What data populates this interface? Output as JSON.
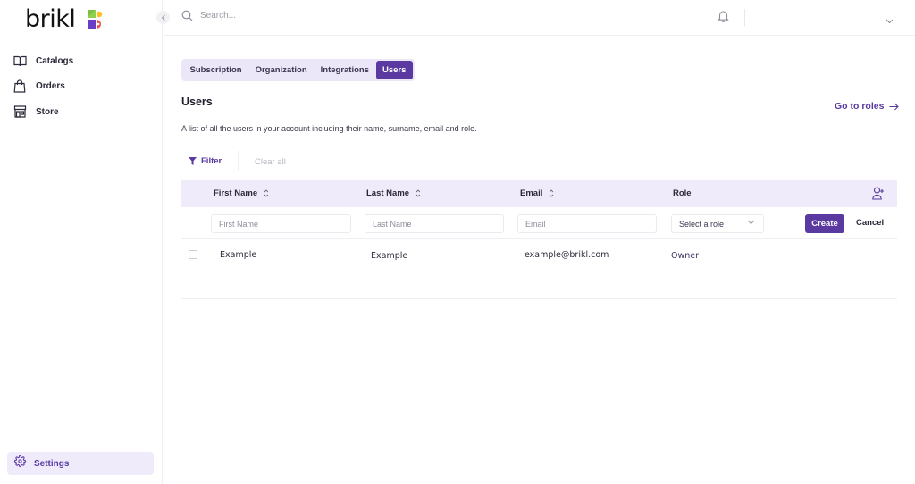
{
  "brand": {
    "name": "brikl",
    "colors": {
      "accent": "#5a3aa0",
      "accent_light": "#efebfb",
      "logo_green": "#7cc242",
      "logo_yellow": "#f7c31c",
      "logo_purple": "#6a3fc7",
      "logo_red": "#ec4a3c"
    }
  },
  "sidebar": {
    "items": [
      {
        "label": "Catalogs",
        "icon": "book-open-icon"
      },
      {
        "label": "Orders",
        "icon": "shopping-bag-icon"
      },
      {
        "label": "Store",
        "icon": "storefront-icon"
      }
    ],
    "settings": {
      "label": "Settings",
      "icon": "gear-icon"
    }
  },
  "topbar": {
    "search_placeholder": "Search..."
  },
  "tabs": [
    {
      "label": "Subscription",
      "active": false
    },
    {
      "label": "Organization",
      "active": false
    },
    {
      "label": "Integrations",
      "active": false
    },
    {
      "label": "Users",
      "active": true
    }
  ],
  "page": {
    "title": "Users",
    "description": "A list of all the users in your account including their name, surname, email and role.",
    "go_to_roles": "Go to roles"
  },
  "filters": {
    "filter_label": "Filter",
    "clear_all_label": "Clear all"
  },
  "table": {
    "columns": [
      {
        "label": "First Name",
        "sortable": true
      },
      {
        "label": "Last Name",
        "sortable": true
      },
      {
        "label": "Email",
        "sortable": true
      },
      {
        "label": "Role",
        "sortable": false
      }
    ],
    "new_row": {
      "first_name_placeholder": "First Name",
      "last_name_placeholder": "Last Name",
      "email_placeholder": "Email",
      "role_placeholder": "Select a role",
      "create_label": "Create",
      "cancel_label": "Cancel"
    },
    "rows": [
      {
        "first_name": "Example",
        "last_name": "Example",
        "email": "example@brikl.com",
        "role": "Owner"
      }
    ]
  }
}
